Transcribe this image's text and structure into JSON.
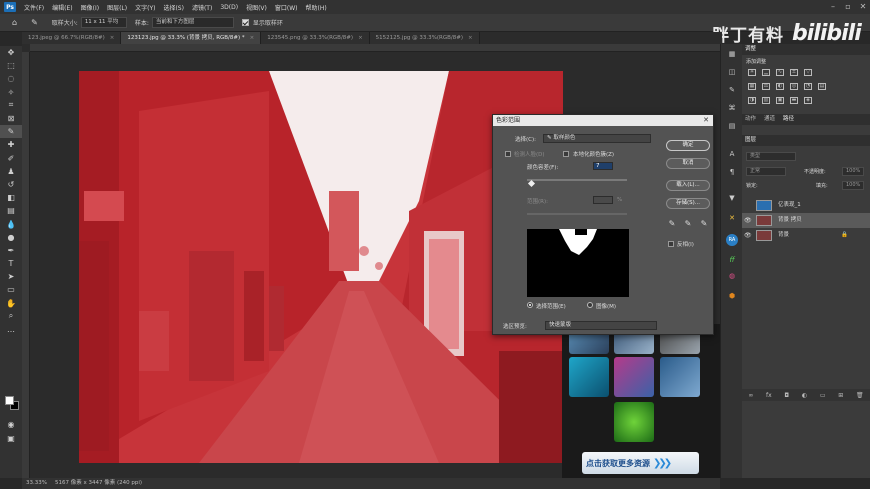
{
  "menubar": {
    "logo": "Ps",
    "items": [
      "文件(F)",
      "编辑(E)",
      "图像(I)",
      "图层(L)",
      "文字(Y)",
      "选择(S)",
      "滤镜(T)",
      "3D(D)",
      "视图(V)",
      "窗口(W)",
      "帮助(H)"
    ]
  },
  "options": {
    "sample_size_label": "取样大小:",
    "sample_size_value": "11 x 11 平均",
    "sample_label": "样本:",
    "sample_value": "当前和下方图层",
    "show_ring_label": "显示取样环"
  },
  "branding": {
    "text": "胖丁有料",
    "bilibili": "bilibili"
  },
  "tabs": [
    {
      "label": "123.jpeg @ 66.7%(RGB/8#)",
      "active": false
    },
    {
      "label": "123123.jpg @ 33.3% (背景 拷贝, RGB/8#) *",
      "active": true
    },
    {
      "label": "123545.png @ 33.3%(RGB/8#)",
      "active": false
    },
    {
      "label": "5152125.jpg @ 33.3%(RGB/8#)",
      "active": false
    }
  ],
  "status": {
    "zoom": "33.33%",
    "doc": "5167 像素 x 3447 像素 (240 ppi)"
  },
  "dialog": {
    "title": "色彩范围",
    "select_label": "选择(C):",
    "select_value": "取样颜色",
    "detect_faces": "检测人脸(D)",
    "localized": "本地化颜色簇(Z)",
    "fuzziness_label": "颜色容差(F):",
    "fuzziness_value": "7",
    "range_label": "范围(R):",
    "range_unit": "%",
    "ok": "确定",
    "cancel": "取消",
    "load": "载入(L)...",
    "save": "存储(S)...",
    "invert": "反相(I)",
    "radio_selection": "选择范围(E)",
    "radio_image": "图像(M)",
    "preview_label": "选区预览:",
    "preview_value": "快速蒙版"
  },
  "ad": {
    "banner_text": "点击获取更多资源",
    "arrows": "❯❯❯"
  },
  "panels": {
    "adjust_tab": "调整",
    "adjust_title": "添加调整",
    "tabs2": [
      "动作",
      "通道",
      "路径"
    ],
    "layers_header": "图层",
    "kind_placeholder": "类型",
    "blend": "正常",
    "opacity_label": "不透明度:",
    "opacity_value": "100%",
    "lock_label": "锁定:",
    "fill_label": "填充:",
    "fill_value": "100%",
    "layers": [
      {
        "name": "亿表现_1",
        "selected": false
      },
      {
        "name": "背景 拷贝",
        "selected": true
      },
      {
        "name": "背景",
        "selected": false
      }
    ]
  },
  "colors": {
    "accent": "#1c6fb7",
    "overlay_red": "#c22b2f"
  }
}
